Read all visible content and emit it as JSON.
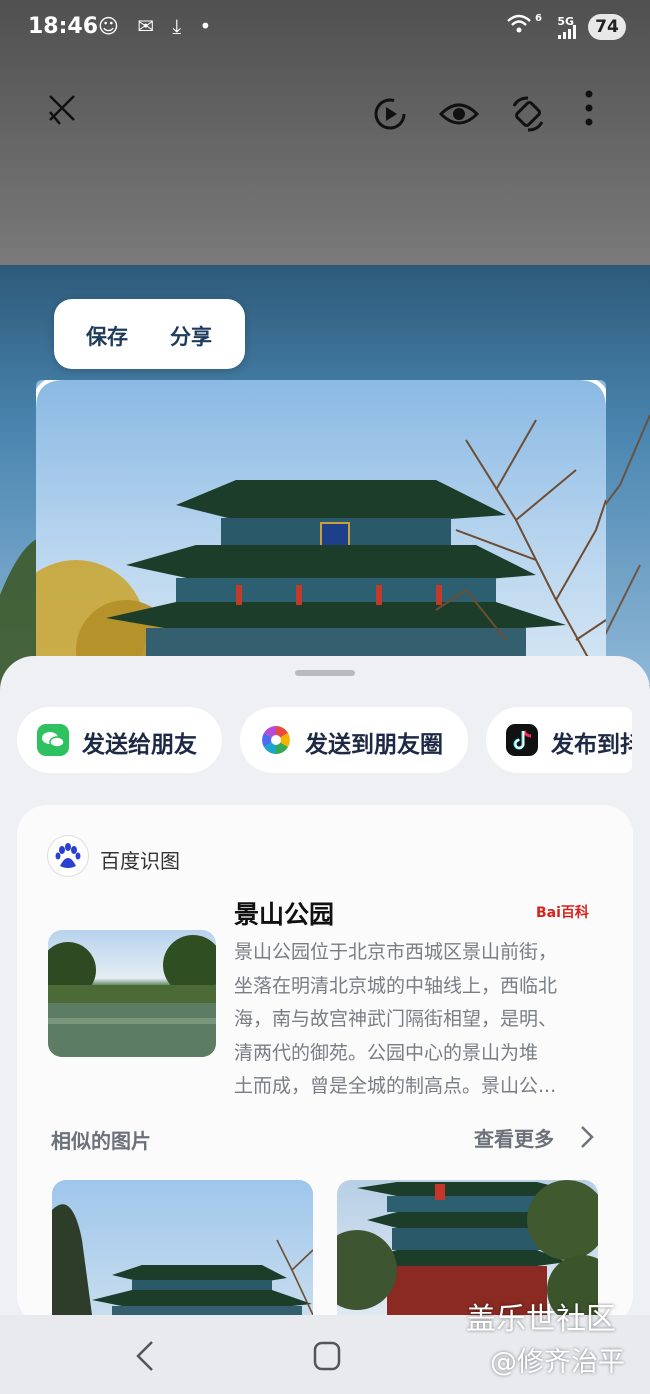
{
  "status": {
    "time": "18:46",
    "network": "5G",
    "battery": "74",
    "wifi_badge": "6"
  },
  "toolbar": {
    "close": "close",
    "replay": "replay",
    "view": "view",
    "rotate": "rotate",
    "more": "more"
  },
  "overlay_actions": {
    "save": "保存",
    "share": "分享"
  },
  "share_chips": [
    {
      "label": "发送给朋友",
      "icon": "wechat-icon",
      "color": "#2dc25f"
    },
    {
      "label": "发送到朋友圈",
      "icon": "moments-icon",
      "color": "#f0a030"
    },
    {
      "label": "发布到抖",
      "icon": "douyin-icon",
      "color": "#111111"
    }
  ],
  "card": {
    "source": "百度识图",
    "title": "景山公园",
    "badge": "Bai百科",
    "description_lines": [
      "景山公园位于北京市西城区景山前街，",
      "坐落在明清北京城的中轴线上，西临北",
      "海，南与故宫神武门隔街相望，是明、",
      "清两代的御苑。公园中心的景山为堆",
      "土而成，曾是全城的制高点。景山公..."
    ],
    "similar_label": "相似的图片",
    "more_label": "查看更多"
  },
  "watermark": {
    "line1": "盖乐世社区",
    "line2": "@修齐治平"
  }
}
